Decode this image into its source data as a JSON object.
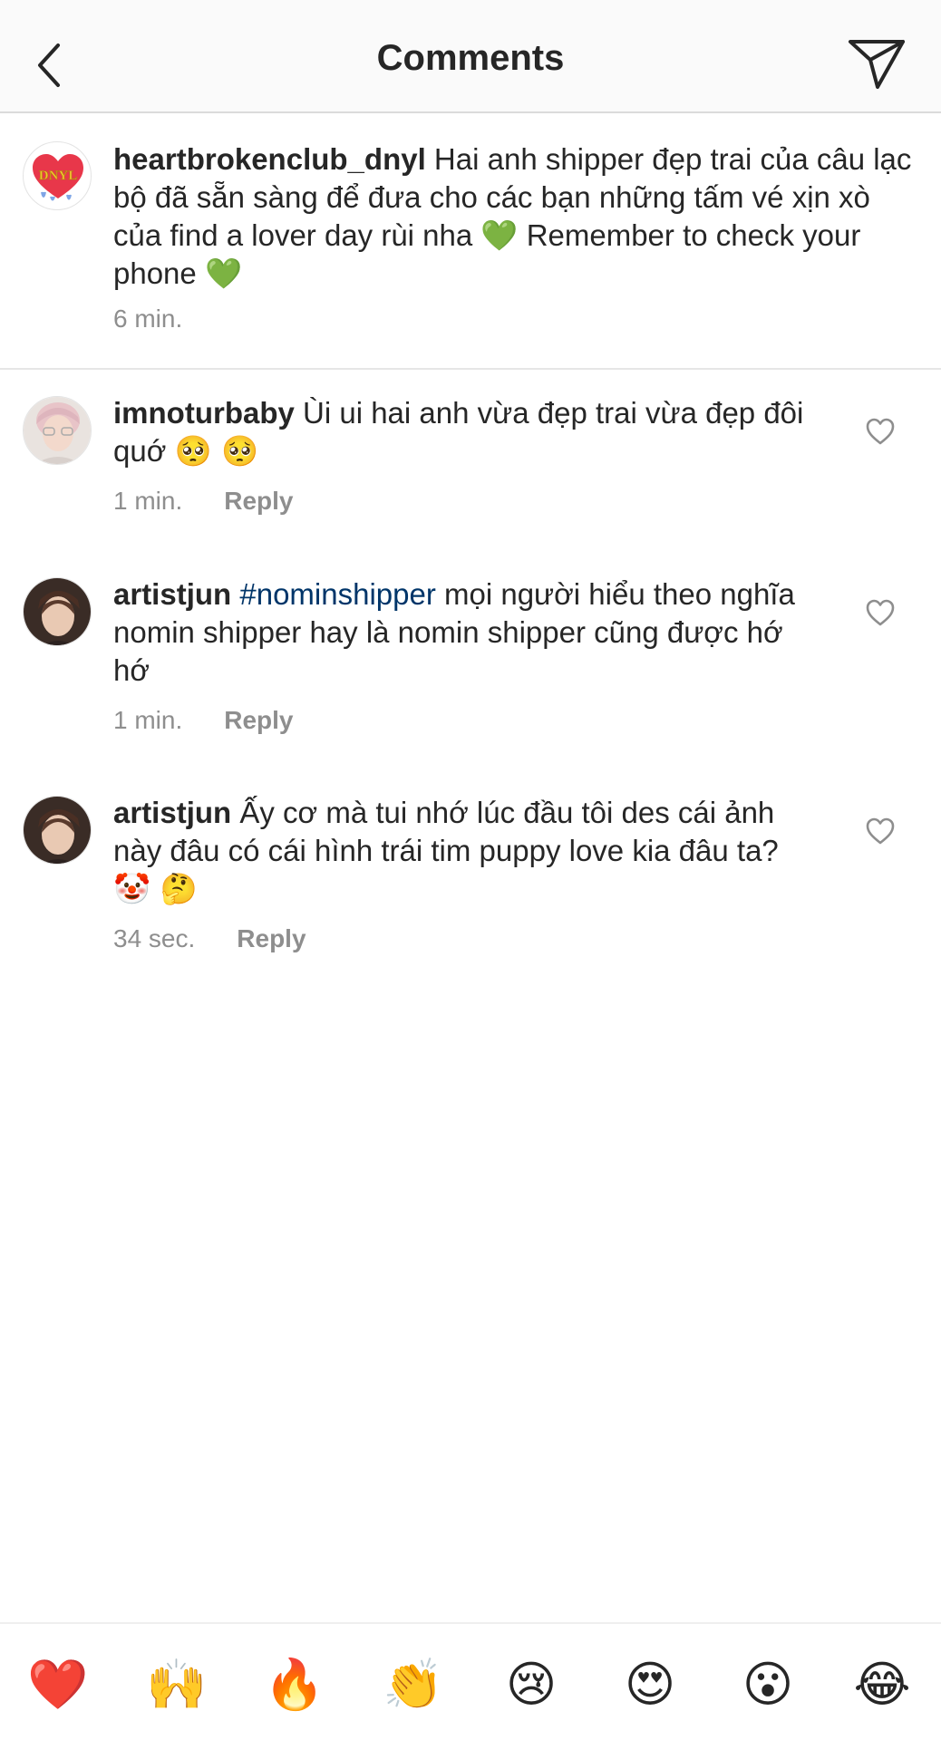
{
  "header": {
    "title": "Comments",
    "back_icon": "chevron-left-icon",
    "send_icon": "paper-plane-icon"
  },
  "caption": {
    "username": "heartbrokenclub_dnyl",
    "text_a": "Hai anh shipper đẹp trai của câu lạc bộ đã sẵn sàng để đưa cho các bạn những tấm vé xịn xò của find a lover day rùi nha",
    "emoji_1": "💚",
    "text_b": "Remember to check your phone",
    "emoji_2": "💚",
    "time": "6 min.",
    "avatar_text": "DNYL",
    "avatar_colors": {
      "heart": "#e8374a",
      "text": "#f2c230",
      "drip": "#7fa6e6"
    }
  },
  "comments": [
    {
      "username": "imnoturbaby",
      "text_a": "Ùi ui hai anh vừa đẹp trai vừa đẹp đôi quớ",
      "emoji": "🥺 🥺",
      "time": "1 min.",
      "reply": "Reply",
      "like_icon": "heart-outline-icon"
    },
    {
      "username": "artistjun",
      "hashtag": "#nominshipper",
      "text_a": "mọi người hiểu theo nghĩa nomin shipper hay là nomin shipper cũng được hớ hớ",
      "time": "1 min.",
      "reply": "Reply",
      "like_icon": "heart-outline-icon"
    },
    {
      "username": "artistjun",
      "text_a": "Ấy cơ mà tui nhớ lúc đầu tôi des cái ảnh này đâu có cái hình trái tim puppy love kia đâu ta?",
      "emoji": "🤡 🤔",
      "time": "34 sec.",
      "reply": "Reply",
      "like_icon": "heart-outline-icon"
    }
  ],
  "emoji_bar": [
    {
      "glyph": "❤️",
      "name": "red-heart"
    },
    {
      "glyph": "🙌",
      "name": "raising-hands"
    },
    {
      "glyph": "🔥",
      "name": "fire"
    },
    {
      "glyph": "👏",
      "name": "clapping-hands"
    },
    {
      "glyph": "😢",
      "name": "crying-face"
    },
    {
      "glyph": "😍",
      "name": "heart-eyes"
    },
    {
      "glyph": "😮",
      "name": "open-mouth"
    },
    {
      "glyph": "😂",
      "name": "tears-of-joy"
    }
  ],
  "colors": {
    "text": "#262626",
    "secondary": "#8e8e8e",
    "hashtag": "#003569",
    "divider": "#dbdbdb"
  }
}
